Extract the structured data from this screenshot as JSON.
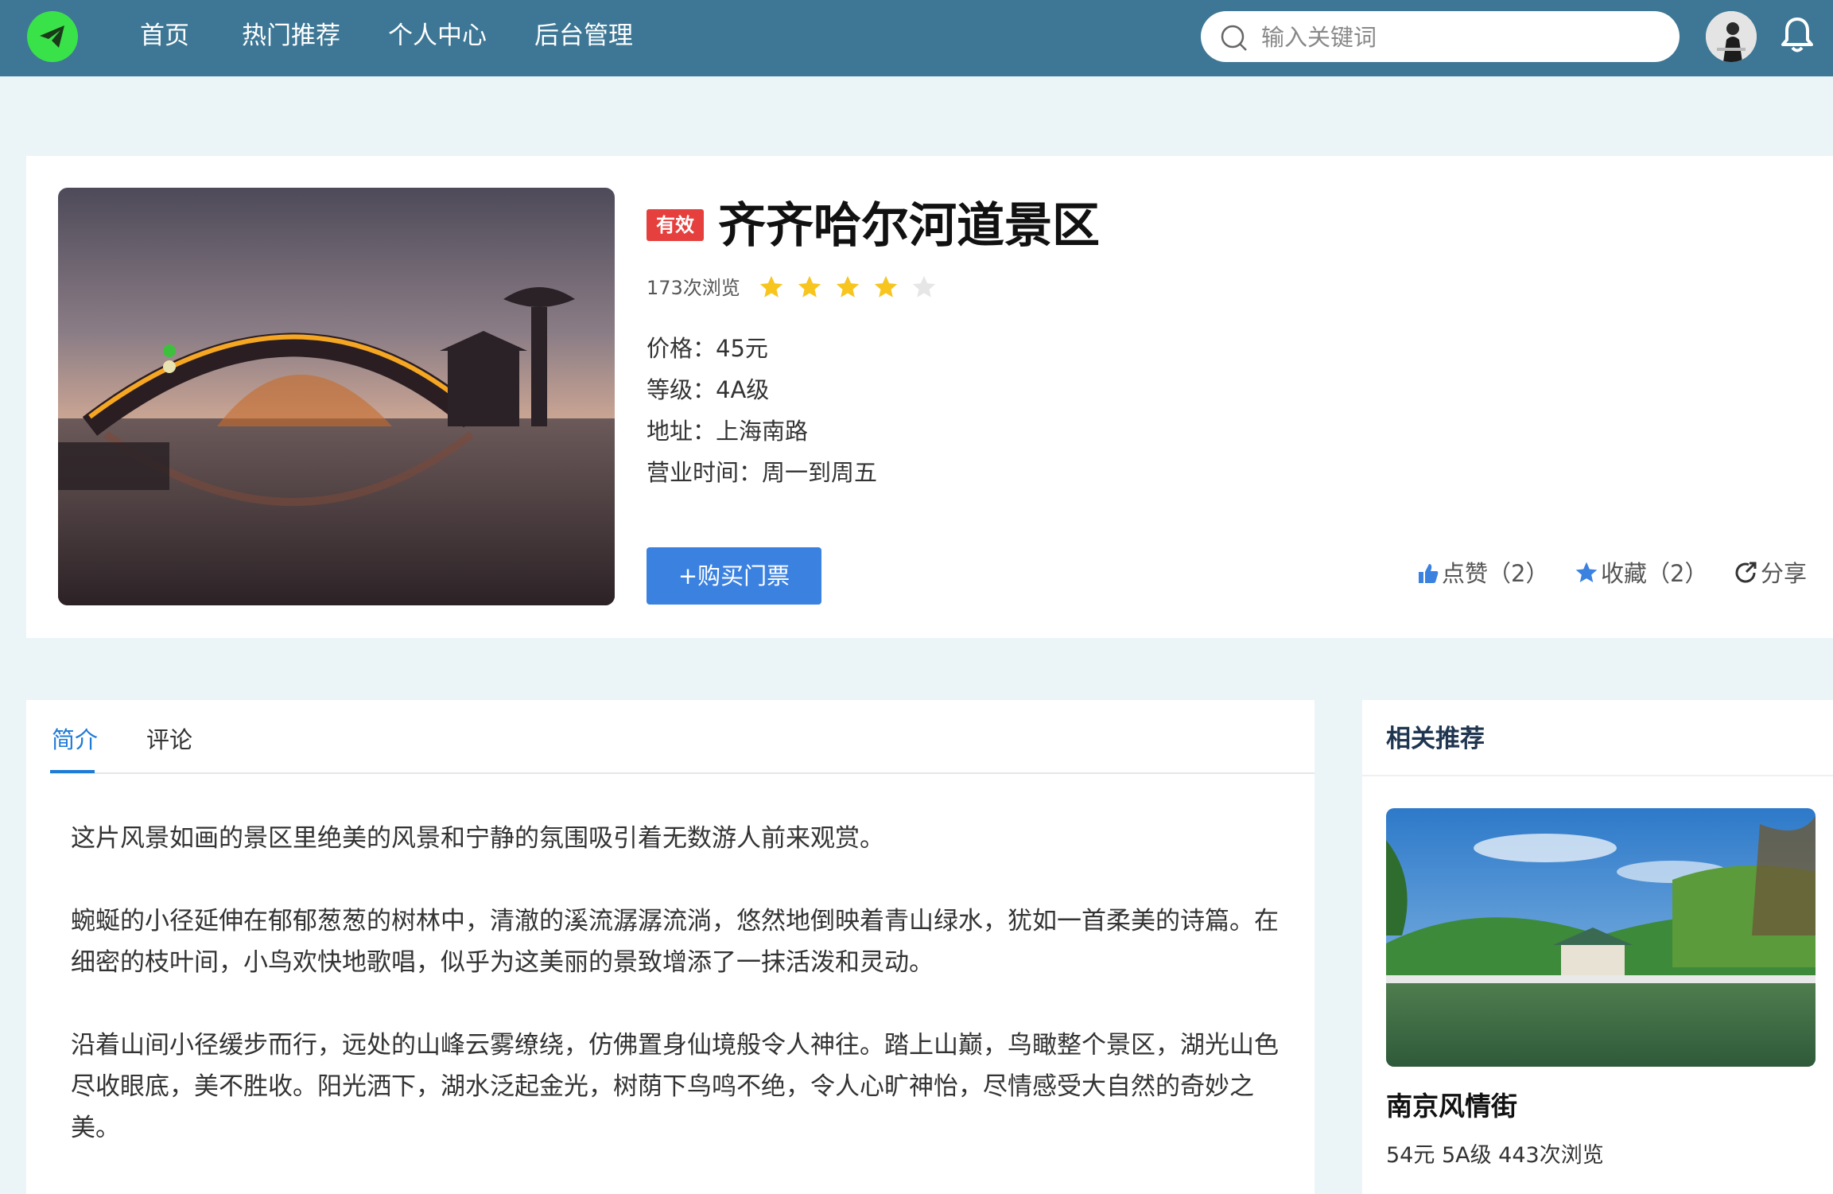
{
  "nav": {
    "items": [
      {
        "label": "首页"
      },
      {
        "label": "热门推荐"
      },
      {
        "label": "个人中心"
      },
      {
        "label": "后台管理"
      }
    ],
    "search_placeholder": "输入关键词"
  },
  "detail": {
    "badge": "有效",
    "title": "齐齐哈尔河道景区",
    "views": "173次浏览",
    "rating": 4,
    "rating_max": 5,
    "price": "价格：45元",
    "level": "等级：4A级",
    "address": "地址：上海南路",
    "hours": "营业时间：周一到周五",
    "buy_label": "+购买门票",
    "like_label": "点赞（2）",
    "fav_label": "收藏（2）",
    "share_label": "分享"
  },
  "tabs": [
    {
      "label": "简介"
    },
    {
      "label": "评论"
    }
  ],
  "intro": {
    "p1": "这片风景如画的景区里绝美的风景和宁静的氛围吸引着无数游人前来观赏。",
    "p2": "蜿蜒的小径延伸在郁郁葱葱的树林中，清澈的溪流潺潺流淌，悠然地倒映着青山绿水，犹如一首柔美的诗篇。在细密的枝叶间，小鸟欢快地歌唱，似乎为这美丽的景致增添了一抹活泼和灵动。",
    "p3": "沿着山间小径缓步而行，远处的山峰云雾缭绕，仿佛置身仙境般令人神往。踏上山巅，鸟瞰整个景区，湖光山色尽收眼底，美不胜收。阳光洒下，湖水泛起金光，树荫下鸟鸣不绝，令人心旷神怡，尽情感受大自然的奇妙之美。"
  },
  "recommend": {
    "title": "相关推荐",
    "item": {
      "name": "南京风情街",
      "meta": "54元  5A级  443次浏览"
    }
  },
  "colors": {
    "nav_bg": "#3d7795",
    "logo": "#3ae24a",
    "badge": "#e5403d",
    "button": "#3b82e0",
    "star_on": "#f7c51e",
    "star_off": "#e6e6e6",
    "tab_active": "#1e7bd6"
  },
  "icons": [
    "paper-plane-icon",
    "search-icon",
    "bell-icon",
    "thumbs-up-icon",
    "star-icon",
    "share-icon"
  ]
}
